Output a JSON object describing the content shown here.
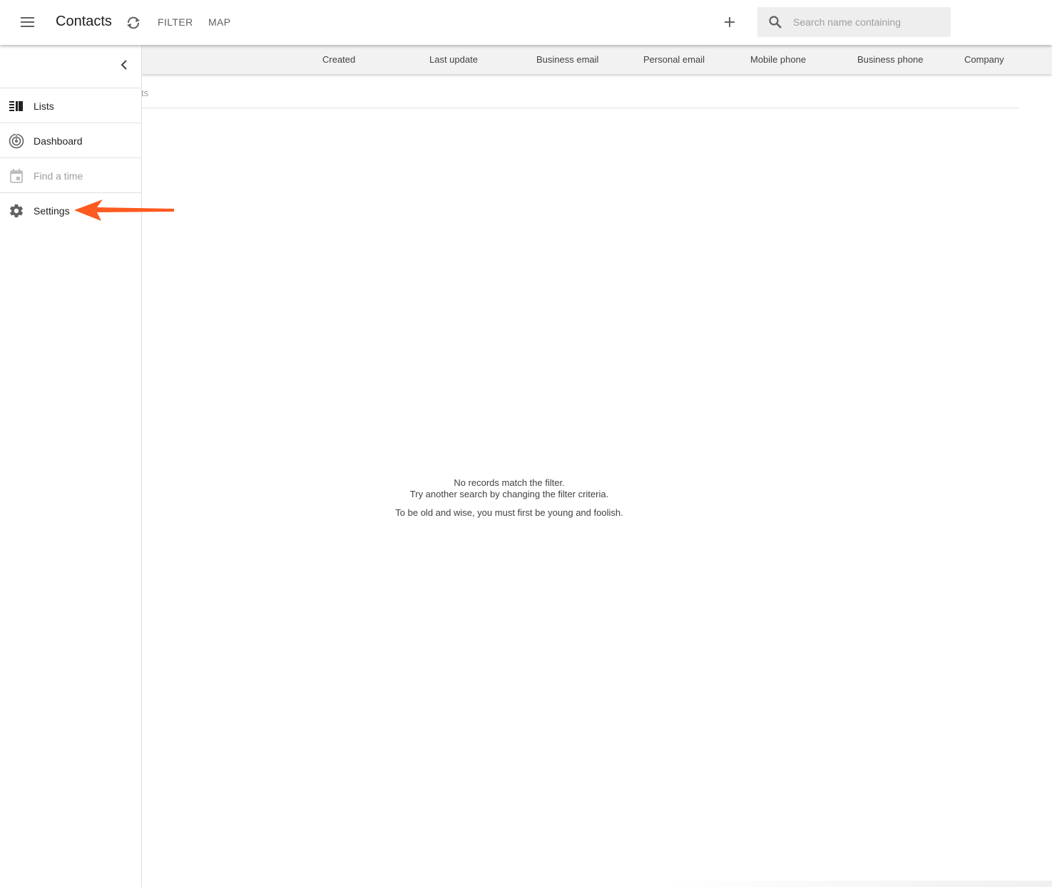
{
  "appbar": {
    "title": "Contacts",
    "filter_label": "FILTER",
    "map_label": "MAP",
    "search_placeholder": "Search name containing"
  },
  "columns": [
    "Created",
    "Last update",
    "Business email",
    "Personal email",
    "Mobile phone",
    "Business phone",
    "Company"
  ],
  "list": {
    "count_text_partial": "ts"
  },
  "empty_state": {
    "line1": "No records match the filter.",
    "line2": "Try another search by changing the filter criteria.",
    "quote": "To be old and wise, you must first be young and foolish."
  },
  "sidebar": {
    "items": [
      {
        "label": "Lists",
        "icon": "lists-icon",
        "disabled": false
      },
      {
        "label": "Dashboard",
        "icon": "dashboard-icon",
        "disabled": false
      },
      {
        "label": "Find a time",
        "icon": "calendar-icon",
        "disabled": true
      },
      {
        "label": "Settings",
        "icon": "gear-icon",
        "disabled": false
      }
    ]
  },
  "colors": {
    "annotation_arrow": "#ff5a1f",
    "header_bg": "#f2f2f2",
    "search_bg": "#eeeeee"
  }
}
